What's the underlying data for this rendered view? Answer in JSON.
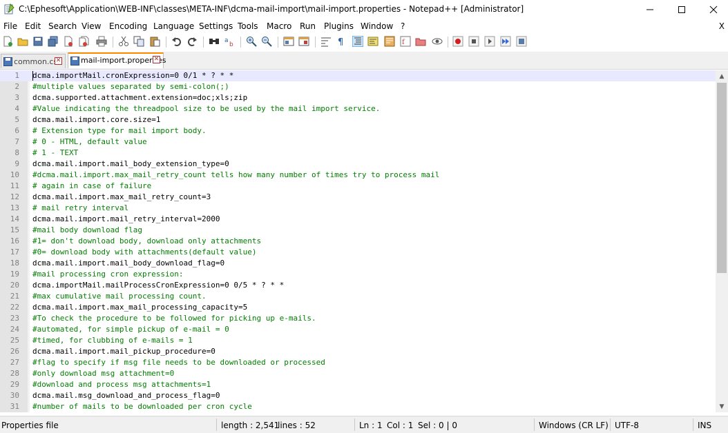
{
  "window": {
    "title": "C:\\Ephesoft\\Application\\WEB-INF\\classes\\META-INF\\dcma-mail-import\\mail-import.properties - Notepad++ [Administrator]",
    "close_document_label": "X"
  },
  "menu": [
    "File",
    "Edit",
    "Search",
    "View",
    "Encoding",
    "Language",
    "Settings",
    "Tools",
    "Macro",
    "Run",
    "Plugins",
    "Window",
    "?"
  ],
  "tabs": [
    {
      "label": "common.css",
      "active": false
    },
    {
      "label": "mail-import.properties",
      "active": true
    }
  ],
  "editor": {
    "current_line": 1,
    "lines": [
      {
        "n": "1",
        "key": "dcma.importMail.cronExpression",
        "value": "0 0/1 * ? * *"
      },
      {
        "n": "2",
        "comment": "#multiple values separated by semi-colon(;)"
      },
      {
        "n": "3",
        "key": "dcma.supported.attachment.extension",
        "value": "doc;xls;zip"
      },
      {
        "n": "4",
        "comment": "#Value indicating the threadpool size to be used by the mail import service."
      },
      {
        "n": "5",
        "key": "dcma.mail.import.core.size",
        "value": "1"
      },
      {
        "n": "6",
        "comment": "# Extension type for mail import body."
      },
      {
        "n": "7",
        "comment": "# 0 - HTML, default value"
      },
      {
        "n": "8",
        "comment": "# 1 - TEXT"
      },
      {
        "n": "9",
        "key": "dcma.mail.import.mail_body_extension_type",
        "value": "0"
      },
      {
        "n": "10",
        "comment": "#dcma.mail.import.max_mail_retry_count tells how many number of times try to process mail"
      },
      {
        "n": "11",
        "comment": "# again in case of failure"
      },
      {
        "n": "12",
        "key": "dcma.mail.import.max_mail_retry_count",
        "value": "3"
      },
      {
        "n": "13",
        "comment": "# mail retry interval"
      },
      {
        "n": "14",
        "key": "dcma.mail.import.mail_retry_interval",
        "value": "2000"
      },
      {
        "n": "15",
        "comment": "#mail body download flag"
      },
      {
        "n": "16",
        "comment": "#1= don't download body, download only attachments"
      },
      {
        "n": "17",
        "comment": "#0= download body with attachments(default value)"
      },
      {
        "n": "18",
        "key": "dcma.mail.import.mail_body_download_flag",
        "value": "0"
      },
      {
        "n": "19",
        "comment": "#mail processing cron expression:"
      },
      {
        "n": "20",
        "key": "dcma.importMail.mailProcessCronExpression",
        "value": "0 0/5 * ? * *"
      },
      {
        "n": "21",
        "comment": "#max cumulative mail processing count."
      },
      {
        "n": "22",
        "key": "dcma.mail.import.max_mail_processing_capacity",
        "value": "5"
      },
      {
        "n": "23",
        "comment": "#To check the procedure to be followed for picking up e-mails."
      },
      {
        "n": "24",
        "comment": "#automated, for simple pickup of e-mail = 0"
      },
      {
        "n": "25",
        "comment": "#timed, for clubbing of e-mails = 1"
      },
      {
        "n": "26",
        "key": "dcma.mail.import.mail_pickup_procedure",
        "value": "0"
      },
      {
        "n": "27",
        "comment": "#flag to specify if msg file needs to be downloaded or processed"
      },
      {
        "n": "28",
        "comment": "#only download msg attachment=0"
      },
      {
        "n": "29",
        "comment": "#download and process msg attachments=1"
      },
      {
        "n": "30",
        "key": "dcma.mail.msg_download_and_process_flag",
        "value": "0"
      },
      {
        "n": "31",
        "comment": "#number of mails to be downloaded per cron cycle"
      }
    ]
  },
  "status": {
    "file_type": "Properties file",
    "length": "length : 2,541",
    "lines": "lines : 52",
    "ln": "Ln : 1",
    "col": "Col : 1",
    "sel": "Sel : 0 | 0",
    "eol": "Windows (CR LF)",
    "encoding": "UTF-8",
    "mode": "INS"
  },
  "colors": {
    "comment": "#008000",
    "current_line": "#e8e8ff",
    "tab_accent": "#fa8c00"
  },
  "scroll": {
    "thumb_fraction": 0.6
  }
}
